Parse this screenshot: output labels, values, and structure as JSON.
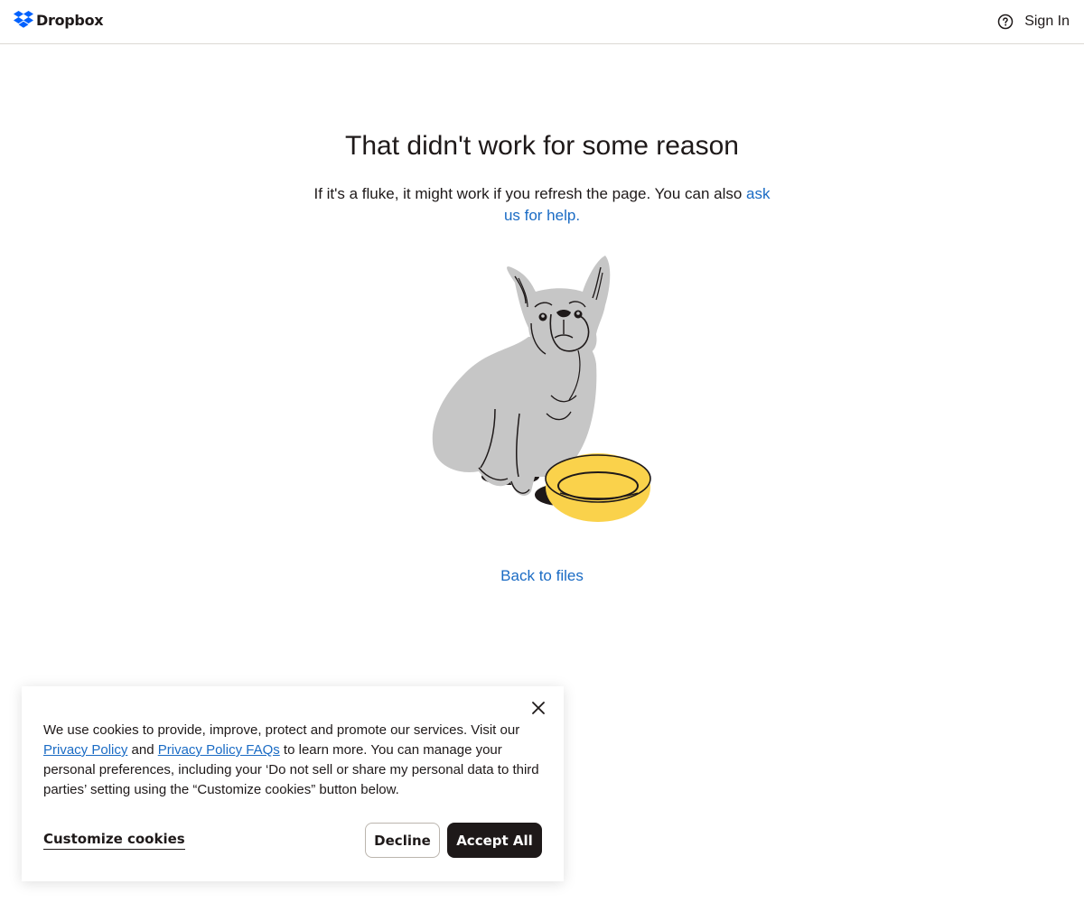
{
  "header": {
    "logo_text": "Dropbox",
    "sign_in_label": "Sign In",
    "help_icon": "help-circle-icon"
  },
  "error": {
    "title": "That didn't work for some reason",
    "message_prefix": "If it's a fluke, it might work if you refresh the page. You can also ",
    "help_link_label": "ask us for help.",
    "back_link_label": "Back to files",
    "illustration": "sad-dog-with-empty-bowl-illustration"
  },
  "cookie_banner": {
    "text_part1": "We use cookies to provide, improve, protect and promote our services. Visit our ",
    "privacy_policy_label": "Privacy Policy",
    "text_and": " and ",
    "privacy_faq_label": "Privacy Policy FAQs",
    "text_part2": " to learn more. You can manage your personal preferences, including your ‘Do not sell or share my personal data to third parties’ setting using the “Customize cookies” button below.",
    "customize_label": "Customize cookies",
    "decline_label": "Decline",
    "accept_label": "Accept All",
    "close_icon": "close-icon"
  },
  "colors": {
    "text": "#1e1919",
    "link": "#1a6bc4",
    "brand_blue": "#0061fe",
    "dog_gray": "#c6c6c6",
    "bowl_yellow": "#fad24b",
    "accept_bg": "#1e1919"
  }
}
